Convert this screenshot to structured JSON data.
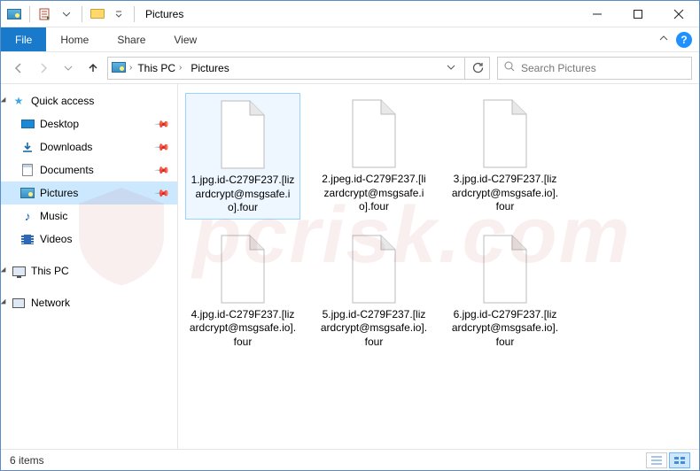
{
  "window": {
    "title": "Pictures"
  },
  "ribbon": {
    "file": "File",
    "tabs": [
      "Home",
      "Share",
      "View"
    ]
  },
  "nav": {
    "breadcrumb": [
      "This PC",
      "Pictures"
    ],
    "search_placeholder": "Search Pictures"
  },
  "sidebar": {
    "quick_access": {
      "label": "Quick access",
      "items": [
        {
          "label": "Desktop",
          "pinned": true,
          "icon": "desktop"
        },
        {
          "label": "Downloads",
          "pinned": true,
          "icon": "downloads"
        },
        {
          "label": "Documents",
          "pinned": true,
          "icon": "documents"
        },
        {
          "label": "Pictures",
          "pinned": true,
          "icon": "pictures",
          "selected": true
        },
        {
          "label": "Music",
          "pinned": false,
          "icon": "music"
        },
        {
          "label": "Videos",
          "pinned": false,
          "icon": "videos"
        }
      ]
    },
    "this_pc": {
      "label": "This PC"
    },
    "network": {
      "label": "Network"
    }
  },
  "files": [
    {
      "name": "1.jpg.id-C279F237.[lizardcrypt@msgsafe.io].four",
      "selected": true
    },
    {
      "name": "2.jpeg.id-C279F237.[lizardcrypt@msgsafe.io].four"
    },
    {
      "name": "3.jpg.id-C279F237.[lizardcrypt@msgsafe.io].four"
    },
    {
      "name": "4.jpg.id-C279F237.[lizardcrypt@msgsafe.io].four"
    },
    {
      "name": "5.jpg.id-C279F237.[lizardcrypt@msgsafe.io].four"
    },
    {
      "name": "6.jpg.id-C279F237.[lizardcrypt@msgsafe.io].four"
    }
  ],
  "status": {
    "text": "6 items"
  },
  "watermark": {
    "text": "pcrisk.com"
  }
}
